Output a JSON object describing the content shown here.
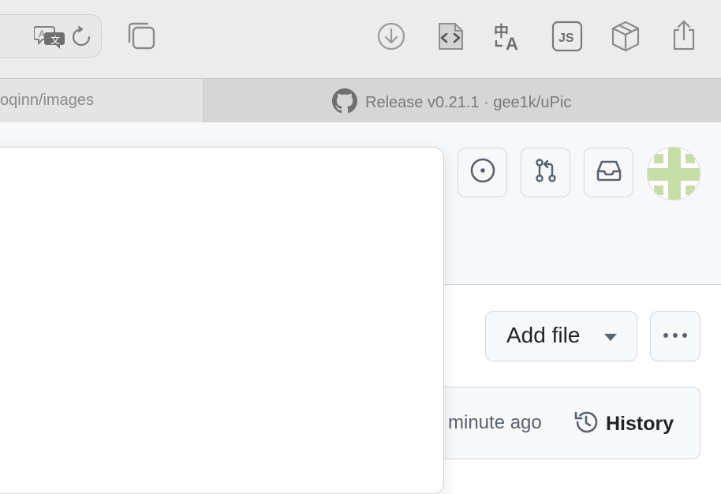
{
  "toolbar": {
    "icons": [
      "translate-icon",
      "reload-icon",
      "tab-overview-icon",
      "download-icon",
      "page-source-icon",
      "chinese-translate-icon",
      "userscript-js-icon",
      "extension-box-icon",
      "share-icon"
    ],
    "js_label": "JS"
  },
  "tabs": [
    {
      "label": "voqinn/images",
      "active": false
    },
    {
      "label": "Release v0.21.1 · gee1k/uPic",
      "active": true,
      "icon": "github-icon"
    }
  ],
  "github": {
    "header_icons": [
      "issues-icon",
      "pull-requests-icon",
      "inbox-icon"
    ],
    "avatar": "user-avatar",
    "add_file_label": "Add file",
    "more_label": "···",
    "commit_time": "minute ago",
    "history_label": "History"
  },
  "colors": {
    "toolbar_bg": "#ececec",
    "page_bg": "#ffffff",
    "header_bg": "#f6f8fa",
    "border": "#d1d9e0",
    "text_primary": "#1f2328",
    "text_muted": "#59636e",
    "avatar_green": "#c6dea6"
  }
}
